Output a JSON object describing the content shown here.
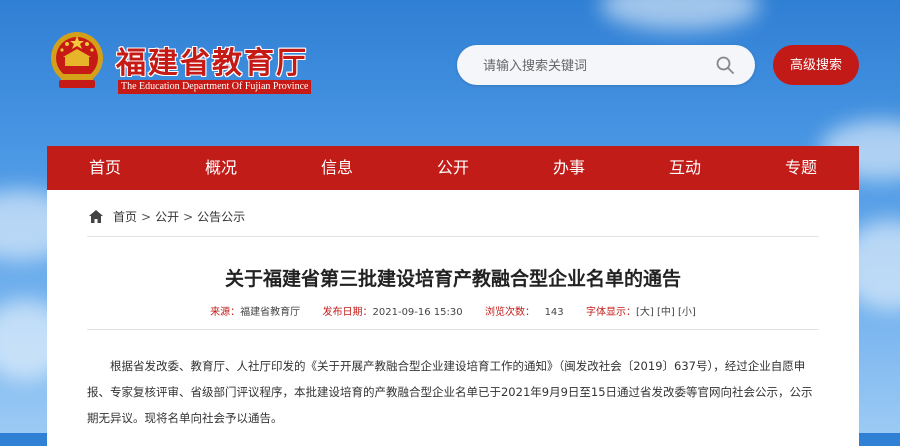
{
  "header": {
    "site_title": "福建省教育厅",
    "site_subtitle": "The Education Department Of Fujian Province",
    "emblem_icon": "national-emblem-icon",
    "brand_red": "#c21c19"
  },
  "search": {
    "placeholder": "请输入搜索关键词",
    "value": "",
    "icon": "search-icon",
    "advanced_label": "高级搜索"
  },
  "nav": {
    "items": [
      {
        "label": "首页"
      },
      {
        "label": "概况"
      },
      {
        "label": "信息"
      },
      {
        "label": "公开"
      },
      {
        "label": "办事"
      },
      {
        "label": "互动"
      },
      {
        "label": "专题"
      }
    ]
  },
  "breadcrumb": {
    "icon": "home-icon",
    "items": [
      "首页",
      "公开",
      "公告公示"
    ],
    "separator": ">"
  },
  "article": {
    "title": "关于福建省第三批建设培育产教融合型企业名单的通告",
    "meta": {
      "source_label": "来源：",
      "source_value": "福建省教育厅",
      "date_label": "发布日期：",
      "date_value": "2021-09-16 15:30",
      "views_label": "浏览次数：",
      "views_value": "143",
      "fontsize_label": "字体显示：",
      "font_large": "[大]",
      "font_medium": "[中]",
      "font_small": "[小]"
    },
    "body": "根据省发改委、教育厅、人社厅印发的《关于开展产教融合型企业建设培育工作的通知》（闽发改社会〔2019〕637号），经过企业自愿申报、专家复核评审、省级部门评议程序，本批建设培育的产教融合型企业名单已于2021年9月9日至15日通过省发改委等官网向社会公示，公示期无异议。现将名单向社会予以通告。"
  }
}
